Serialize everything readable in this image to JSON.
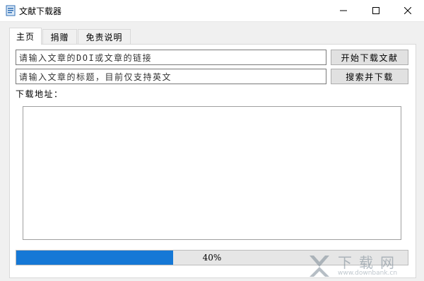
{
  "window": {
    "title": "文献下载器",
    "icon": "document-icon"
  },
  "tabs": [
    {
      "label": "主页",
      "active": true
    },
    {
      "label": "捐赠",
      "active": false
    },
    {
      "label": "免责说明",
      "active": false
    }
  ],
  "main": {
    "doi_input": {
      "placeholder": "请输入文章的DOI或文章的链接",
      "value": ""
    },
    "start_button": "开始下载文献",
    "title_input": {
      "placeholder": "请输入文章的标题，目前仅支持英文",
      "value": ""
    },
    "search_button": "搜索并下载",
    "address_label": "下载地址：",
    "progress": {
      "value": 0.4,
      "text": "40%"
    }
  },
  "watermark": {
    "name": "下载网",
    "url": "www.downbank.cn"
  },
  "colors": {
    "progress_fill": "#1578d6",
    "client_bg": "#f0f0f0"
  }
}
